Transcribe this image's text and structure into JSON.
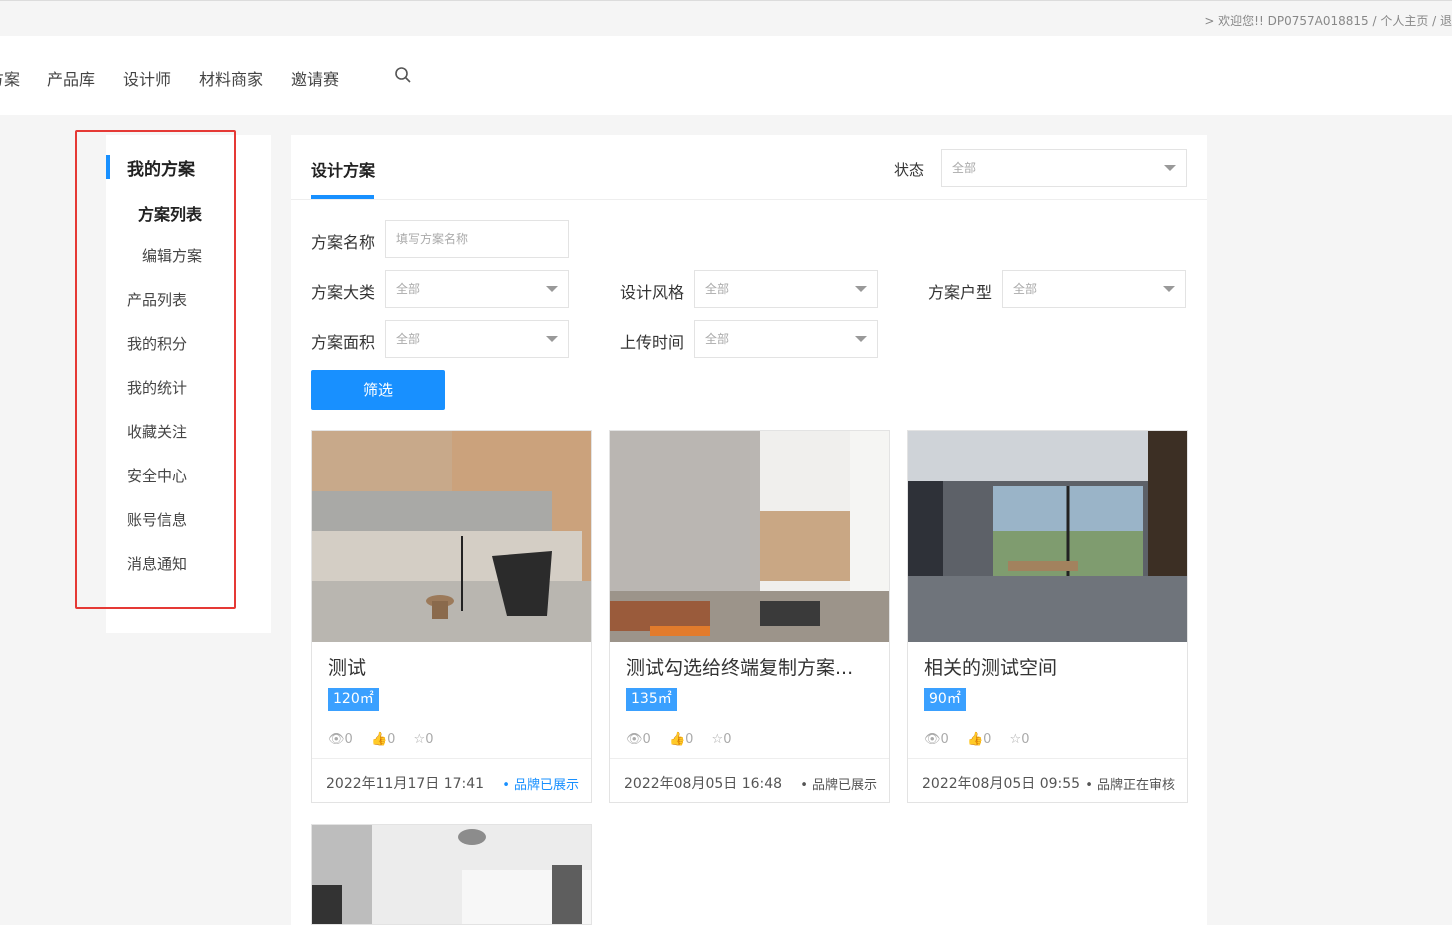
{
  "topbar": {
    "user_text": "> 欢迎您!! DP0757A018815 / 个人主页 / 退"
  },
  "nav": {
    "items": [
      "方案",
      "产品库",
      "设计师",
      "材料商家",
      "邀请赛"
    ],
    "search_icon": "search-icon"
  },
  "sidebar": {
    "title": "我的方案",
    "sub_active": "方案列表",
    "sub_edit": "编辑方案",
    "items": [
      "产品列表",
      "我的积分",
      "我的统计",
      "收藏关注",
      "安全中心",
      "账号信息",
      "消息通知"
    ]
  },
  "main": {
    "tab": "设计方案",
    "status_label": "状态",
    "status_value": "全部"
  },
  "filters": {
    "name_label": "方案名称",
    "name_placeholder": "填写方案名称",
    "category_label": "方案大类",
    "category_value": "全部",
    "style_label": "设计风格",
    "style_value": "全部",
    "house_label": "方案户型",
    "house_value": "全部",
    "area_label": "方案面积",
    "area_value": "全部",
    "upload_label": "上传时间",
    "upload_value": "全部",
    "submit": "筛选"
  },
  "cards": [
    {
      "title": "测试",
      "area": "120㎡",
      "views": "0",
      "likes": "0",
      "favs": "0",
      "date": "2022年11月17日 17:41",
      "state": "• 品牌已展示",
      "state_color": "#1890ff"
    },
    {
      "title": "测试勾选给终端复制方案...",
      "area": "135㎡",
      "views": "0",
      "likes": "0",
      "favs": "0",
      "date": "2022年08月05日 16:48",
      "state": "• 品牌已展示",
      "state_color": "#555555"
    },
    {
      "title": "相关的测试空间",
      "area": "90㎡",
      "views": "0",
      "likes": "0",
      "favs": "0",
      "date": "2022年08月05日 09:55",
      "state": "• 品牌正在审核",
      "state_color": "#555555"
    }
  ],
  "colors": {
    "accent": "#1890ff",
    "highlight_border": "#e53935"
  }
}
